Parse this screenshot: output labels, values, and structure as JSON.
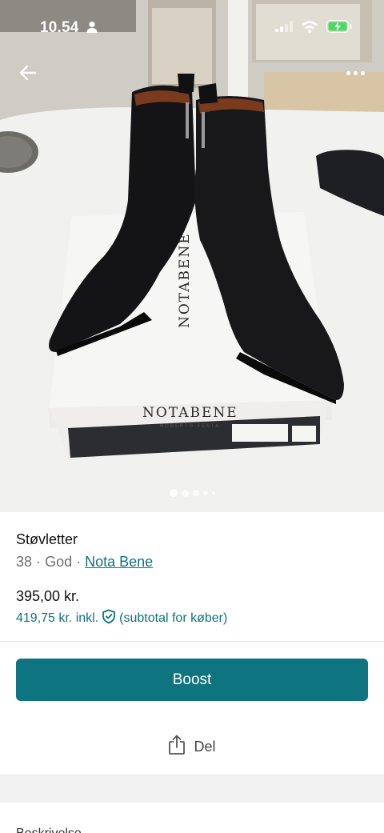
{
  "status_bar": {
    "time": "10.54"
  },
  "photo": {
    "image_count": 5,
    "active_index": 0
  },
  "listing": {
    "title": "Støvletter",
    "size": "38",
    "separator": "·",
    "condition": "God",
    "brand": "Nota Bene",
    "price": "395,00 kr.",
    "total_price": "419,75 kr. inkl.",
    "total_note": "(subtotal for køber)"
  },
  "actions": {
    "boost_label": "Boost",
    "share_label": "Del"
  },
  "description": {
    "heading": "Beskrivelse"
  },
  "colors": {
    "accent": "#0e7480",
    "link": "#0c7380"
  }
}
